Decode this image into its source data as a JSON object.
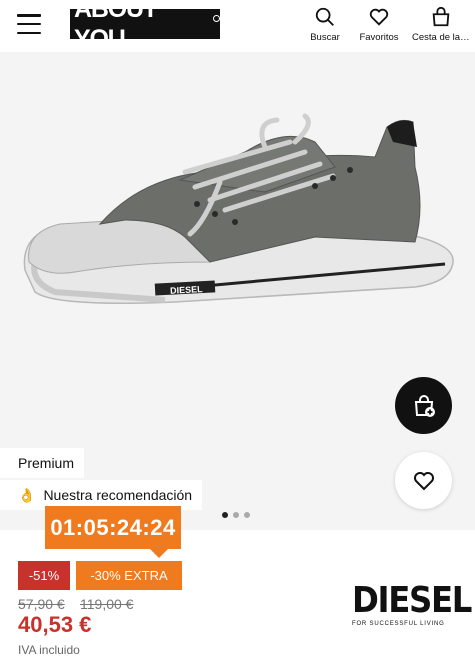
{
  "header": {
    "logo_text": "ABOUT YOU",
    "search_label": "Buscar",
    "favorites_label": "Favoritos",
    "cart_label": "Cesta de la compra"
  },
  "product": {
    "tags": {
      "premium": "Premium",
      "recommendation": "Nuestra recomendación"
    },
    "gallery": {
      "image_count": 3,
      "active_index": 0
    },
    "timer": "01:05:24:24",
    "discount_badge": "-51%",
    "extra_badge": "-30% EXTRA",
    "old_price_1": "57,90 €",
    "old_price_2": "119,00 €",
    "price": "40,53 €",
    "vat_note": "IVA incluido",
    "brand": {
      "name": "DIESEL",
      "tagline": "FOR SUCCESSFUL LIVING"
    },
    "shoe_logo_text": "DIESEL"
  },
  "colors": {
    "accent_orange": "#f07a1e",
    "discount_red": "#c8322c",
    "image_bg": "#f4f4f4"
  }
}
